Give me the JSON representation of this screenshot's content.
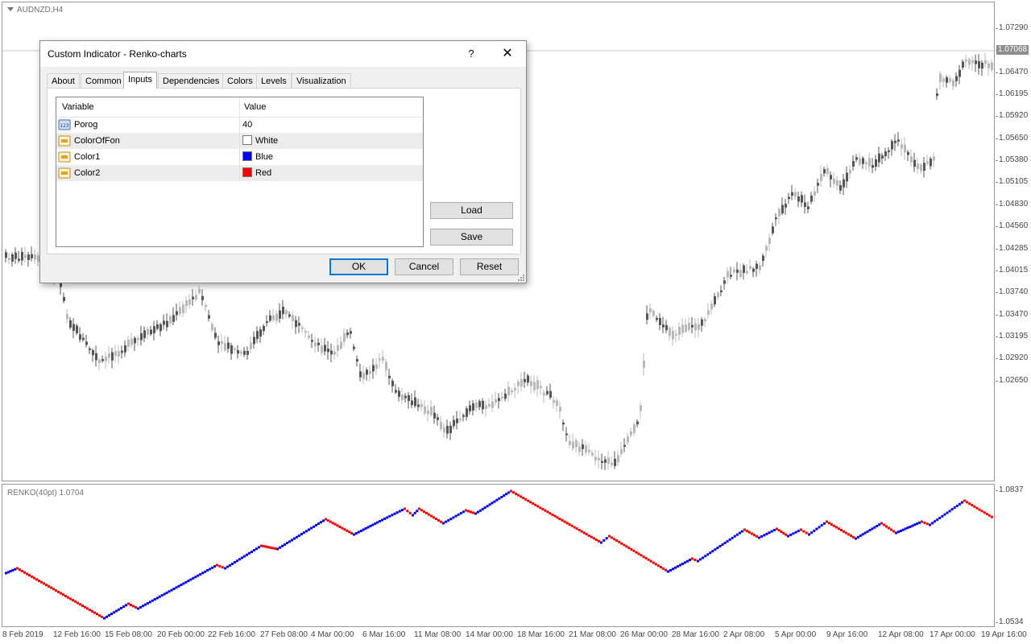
{
  "chart": {
    "symbol_title": "AUDNZD,H4",
    "indicator_title": "RENKO(40pt) 1.0704",
    "current_price": "1.07068",
    "price_labels": [
      "1.07290",
      "1.06740",
      "1.06470",
      "1.06195",
      "1.05920",
      "1.05650",
      "1.05380",
      "1.05105",
      "1.04830",
      "1.04560",
      "1.04285",
      "1.04015",
      "1.03740",
      "1.03470",
      "1.03195",
      "1.02920",
      "1.02650"
    ],
    "sub_price_labels": [
      "1.0837",
      "1.0534"
    ],
    "time_labels": [
      "8 Feb 2019",
      "12 Feb 16:00",
      "15 Feb 08:00",
      "20 Feb 00:00",
      "22 Feb 16:00",
      "27 Feb 08:00",
      "4 Mar 00:00",
      "6 Mar 16:00",
      "11 Mar 08:00",
      "14 Mar 00:00",
      "18 Mar 16:00",
      "21 Mar 08:00",
      "26 Mar 00:00",
      "28 Mar 16:00",
      "2 Apr 08:00",
      "5 Apr 00:00",
      "9 Apr 16:00",
      "12 Apr 08:00",
      "17 Apr 00:00",
      "19 Apr 16:00"
    ],
    "colors": {
      "up": "#0000ff",
      "down": "#ff0000",
      "candle": "#b8b8b8",
      "candle_dark": "#555555"
    }
  },
  "dialog": {
    "title": "Custom Indicator - Renko-charts",
    "help": "?",
    "close": "✕",
    "tabs": [
      "About",
      "Common",
      "Inputs",
      "Dependencies",
      "Colors",
      "Levels",
      "Visualization"
    ],
    "active_tab": "Inputs",
    "table": {
      "headers": [
        "Variable",
        "Value"
      ],
      "rows": [
        {
          "variable": "Porog",
          "value": "40",
          "icon": "number-icon"
        },
        {
          "variable": "ColorOfFon",
          "value": "White",
          "icon": "color-param-icon",
          "swatch": "#ffffff"
        },
        {
          "variable": "Color1",
          "value": "Blue",
          "icon": "color-param-icon",
          "swatch": "#0000ff"
        },
        {
          "variable": "Color2",
          "value": "Red",
          "icon": "color-param-icon",
          "swatch": "#ff0000"
        }
      ]
    },
    "buttons": {
      "load": "Load",
      "save": "Save",
      "ok": "OK",
      "cancel": "Cancel",
      "reset": "Reset"
    }
  }
}
